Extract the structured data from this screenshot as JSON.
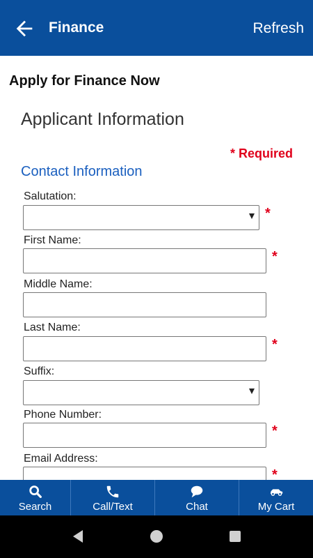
{
  "appbar": {
    "title": "Finance",
    "refresh_label": "Refresh",
    "back_icon": "arrow-left-icon",
    "background": "#0a4f9c"
  },
  "page": {
    "heading": "Apply for Finance Now",
    "section_title": "Applicant Information",
    "required_note": "* Required",
    "subsection_title": "Contact Information"
  },
  "form": {
    "fields": [
      {
        "label": "Salutation:",
        "type": "select",
        "value": "",
        "required": true
      },
      {
        "label": "First Name:",
        "type": "text",
        "value": "",
        "required": true
      },
      {
        "label": "Middle Name:",
        "type": "text",
        "value": "",
        "required": false
      },
      {
        "label": "Last Name:",
        "type": "text",
        "value": "",
        "required": true
      },
      {
        "label": "Suffix:",
        "type": "select",
        "value": "",
        "required": false
      },
      {
        "label": "Phone Number:",
        "type": "text",
        "value": "",
        "required": true
      },
      {
        "label": "Email Address:",
        "type": "text",
        "value": "",
        "required": true
      }
    ],
    "required_marker": "*"
  },
  "bottom_nav": {
    "items": [
      {
        "label": "Search",
        "icon": "search-icon"
      },
      {
        "label": "Call/Text",
        "icon": "phone-icon"
      },
      {
        "label": "Chat",
        "icon": "chat-bubble-icon"
      },
      {
        "label": "My Cart",
        "icon": "car-icon"
      }
    ]
  },
  "system_nav": {
    "buttons": [
      "back-triangle-icon",
      "home-circle-icon",
      "recents-square-icon"
    ]
  },
  "colors": {
    "brand_blue": "#0a4f9c",
    "link_blue": "#1a5fbf",
    "required_red": "#e0001b"
  }
}
